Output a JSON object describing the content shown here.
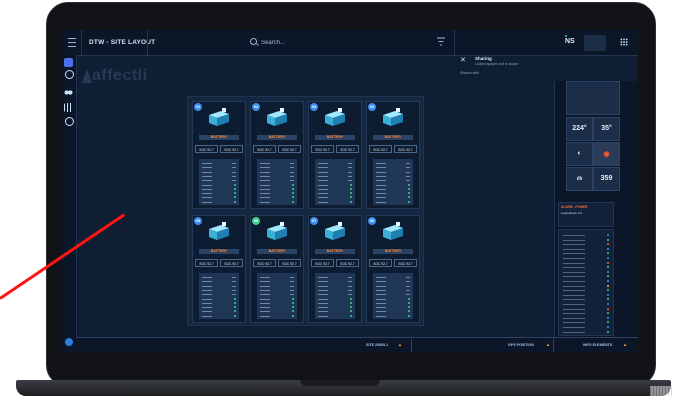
{
  "app": {
    "title": "DTW - SITE LAYOUT",
    "logo_text": "affectli",
    "search_placeholder": "Search...",
    "user_initials": "NS"
  },
  "notification": {
    "title": "Sharing",
    "subtitle": "Linked spaces not in scope",
    "meta": "Shared with"
  },
  "batteries": [
    {
      "num": "01",
      "name": "BATTERY",
      "soc1": "SOC 92.7",
      "soc2": "SOC 92.7",
      "num_color": "#3b8ef0"
    },
    {
      "num": "02",
      "name": "BATTERY",
      "soc1": "SOC 92.7",
      "soc2": "SOC 92.7",
      "num_color": "#3b8ef0"
    },
    {
      "num": "03",
      "name": "BATTERY",
      "soc1": "SOC 92.7",
      "soc2": "SOC 92.7",
      "num_color": "#3b8ef0"
    },
    {
      "num": "04",
      "name": "BATTERY",
      "soc1": "SOC 92.7",
      "soc2": "SOC 92.7",
      "num_color": "#3b8ef0"
    },
    {
      "num": "05",
      "name": "BATTERY",
      "soc1": "SOC 92.7",
      "soc2": "SOC 92.7",
      "num_color": "#3b8ef0"
    },
    {
      "num": "06",
      "name": "BATTERY",
      "soc1": "SOC 92.7",
      "soc2": "SOC 92.7",
      "num_color": "#3fd18b"
    },
    {
      "num": "07",
      "name": "BATTERY",
      "soc1": "SOC 92.7",
      "soc2": "SOC 92.7",
      "num_color": "#3b8ef0"
    },
    {
      "num": "08",
      "name": "BATTERY",
      "soc1": "SOC 92.7",
      "soc2": "SOC 92.7",
      "num_color": "#3b8ef0"
    }
  ],
  "right_panel": {
    "tile_a": "224°",
    "tile_b": "35°",
    "tile_c": "359",
    "alarm_title": "ALARM - POWER",
    "alarm_text": "Load above 1.0"
  },
  "bottom_bar": {
    "site_label": "SITE 23005-1",
    "gps_label": "GPS POSITION",
    "info_label": "INFO ELEMENTS"
  },
  "colors": {
    "accent": "#3b8ef0",
    "orange": "#ff8a3d",
    "ok": "#3fd18b",
    "pointer": "#ff1414"
  }
}
